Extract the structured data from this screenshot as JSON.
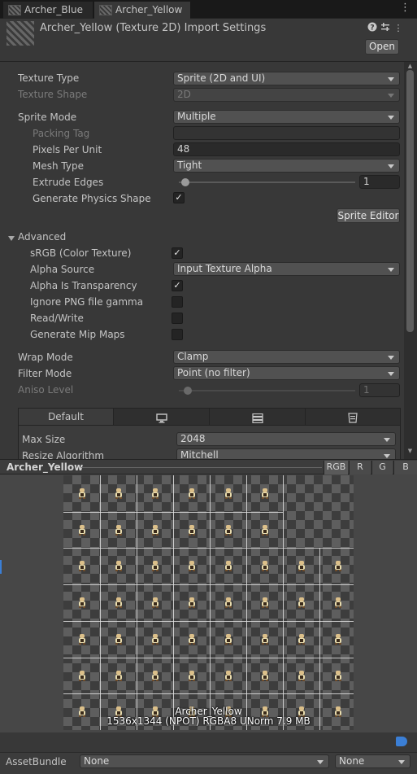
{
  "tabs": [
    {
      "label": "Archer_Blue"
    },
    {
      "label": "Archer_Yellow"
    }
  ],
  "header": {
    "title": "Archer_Yellow (Texture 2D) Import Settings",
    "open_label": "Open",
    "icons": [
      "help-icon",
      "presets-icon",
      "more-icon"
    ]
  },
  "settings": {
    "texture_type": {
      "label": "Texture Type",
      "value": "Sprite (2D and UI)"
    },
    "texture_shape": {
      "label": "Texture Shape",
      "value": "2D"
    },
    "sprite_mode": {
      "label": "Sprite Mode",
      "value": "Multiple"
    },
    "packing_tag": {
      "label": "Packing Tag",
      "value": ""
    },
    "pixels_per_unit": {
      "label": "Pixels Per Unit",
      "value": "48"
    },
    "mesh_type": {
      "label": "Mesh Type",
      "value": "Tight"
    },
    "extrude_edges": {
      "label": "Extrude Edges",
      "value": "1"
    },
    "generate_physics_shape": {
      "label": "Generate Physics Shape",
      "checked": true
    },
    "sprite_editor_label": "Sprite Editor"
  },
  "advanced": {
    "title": "Advanced",
    "srgb": {
      "label": "sRGB (Color Texture)",
      "checked": true
    },
    "alpha_source": {
      "label": "Alpha Source",
      "value": "Input Texture Alpha"
    },
    "alpha_is_transparency": {
      "label": "Alpha Is Transparency",
      "checked": true
    },
    "ignore_png_gamma": {
      "label": "Ignore PNG file gamma",
      "checked": false
    },
    "read_write": {
      "label": "Read/Write",
      "checked": false
    },
    "generate_mip_maps": {
      "label": "Generate Mip Maps",
      "checked": false
    }
  },
  "sampling": {
    "wrap_mode": {
      "label": "Wrap Mode",
      "value": "Clamp"
    },
    "filter_mode": {
      "label": "Filter Mode",
      "value": "Point (no filter)"
    },
    "aniso_level": {
      "label": "Aniso Level",
      "value": "1"
    }
  },
  "platform": {
    "tabs": [
      {
        "label": "Default"
      },
      {
        "icon": "monitor-icon"
      },
      {
        "icon": "server-icon"
      },
      {
        "icon": "webgl-icon"
      }
    ],
    "max_size": {
      "label": "Max Size",
      "value": "2048"
    },
    "resize_algorithm": {
      "label": "Resize Algorithm",
      "value": "Mitchell"
    }
  },
  "preview": {
    "title": "Archer_Yellow",
    "channels": [
      "RGB",
      "R",
      "G",
      "B"
    ],
    "overlay_name": "Archer_Yellow",
    "overlay_info": "1536x1344 (NPOT)  RGBA8 UNorm  7.9 MB"
  },
  "assetbundle": {
    "label": "AssetBundle",
    "name": "None",
    "variant": "None"
  }
}
